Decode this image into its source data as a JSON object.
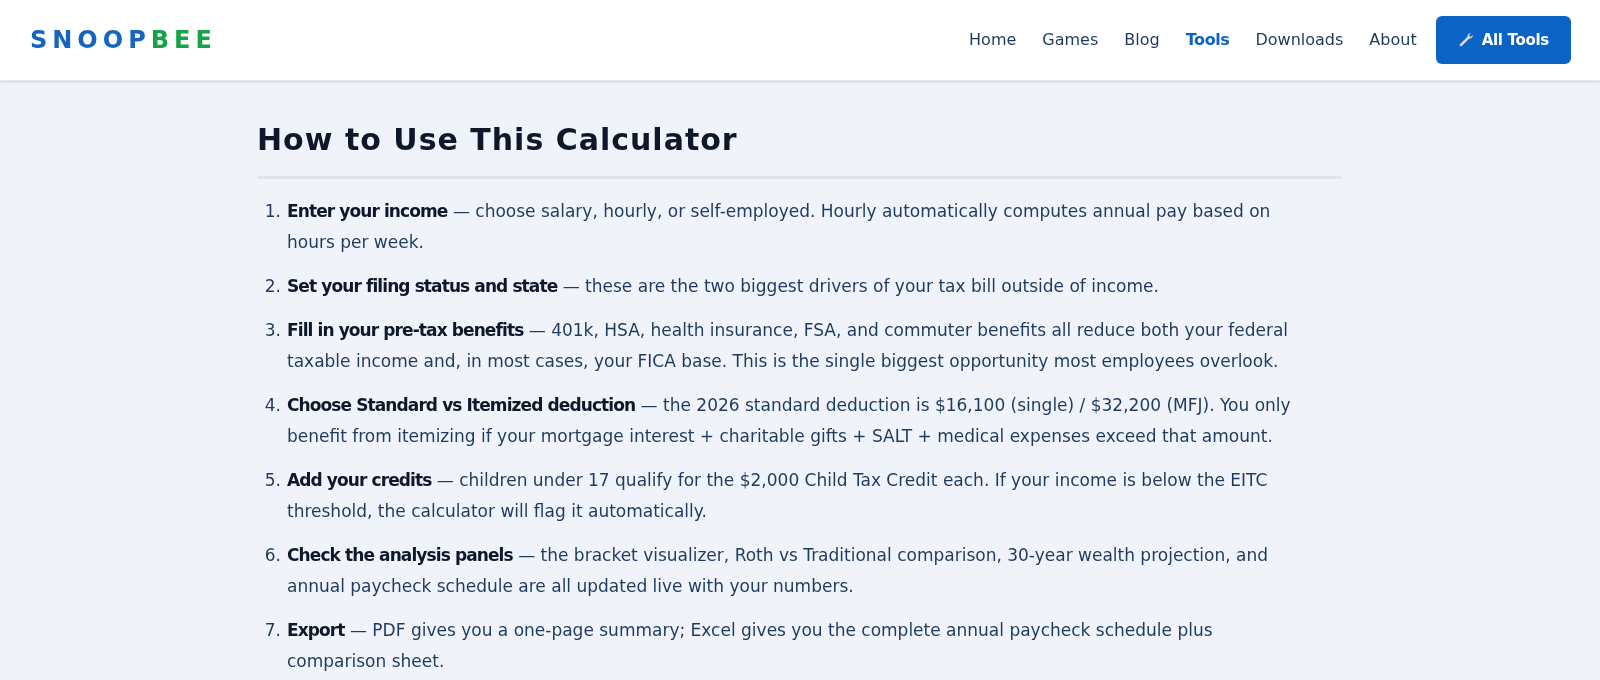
{
  "header": {
    "logo": [
      {
        "text": "SNOOP",
        "color": "#1565c0"
      },
      {
        "text": "BEE",
        "color": "#16a34a"
      }
    ],
    "nav": [
      {
        "label": "Home",
        "selected": false
      },
      {
        "label": "Games",
        "selected": false
      },
      {
        "label": "Blog",
        "selected": false
      },
      {
        "label": "Tools",
        "selected": true
      },
      {
        "label": "Downloads",
        "selected": false
      },
      {
        "label": "About",
        "selected": false
      }
    ],
    "button": {
      "label": "All Tools"
    }
  },
  "article": {
    "title": "How to Use This Calculator",
    "steps": [
      {
        "number": "1.",
        "text": "**Enter your income** — choose salary, hourly, or self-employed. Hourly automatically computes annual pay based on hours per week."
      },
      {
        "number": "2.",
        "text": "**Set your filing status and state** — these are the two biggest drivers of your tax bill outside of income."
      },
      {
        "number": "3.",
        "text": "**Fill in your pre-tax benefits** — 401k, HSA, health insurance, FSA, and commuter benefits all reduce both your federal taxable income and, in most cases, your FICA base. This is the single biggest opportunity most employees overlook."
      },
      {
        "number": "4.",
        "text": "**Choose Standard vs Itemized deduction** — the 2026 standard deduction is $16,100 (single) / $32,200 (MFJ). You only benefit from itemizing if your mortgage interest + charitable gifts + SALT + medical expenses exceed that amount."
      },
      {
        "number": "5.",
        "text": "**Add your credits** — children under 17 qualify for the $2,000 Child Tax Credit each. If your income is below the EITC threshold, the calculator will flag it automatically."
      },
      {
        "number": "6.",
        "text": "**Check the analysis panels** — the bracket visualizer, Roth vs Traditional comparison, 30-year wealth projection, and annual paycheck schedule are all updated live with your numbers."
      },
      {
        "number": "7.",
        "text": "**Export** — PDF gives you a one-page summary; Excel gives you the complete annual paycheck schedule plus comparison sheet."
      }
    ]
  }
}
